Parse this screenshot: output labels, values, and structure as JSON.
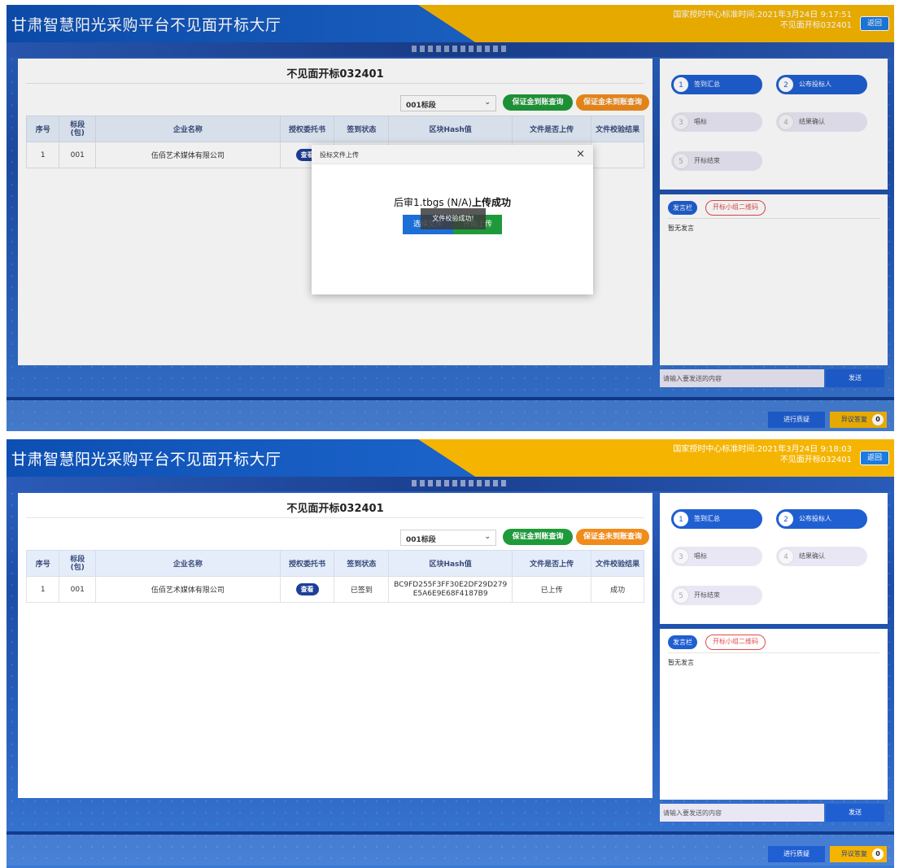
{
  "shot1": {
    "header": {
      "title": "甘肃智慧阳光采购平台不见面开标大厅",
      "time_text": "国家授时中心标准时间:2021年3月24日 9:17:51",
      "room_name": "不见面开标032401",
      "back_label": "返回"
    },
    "panel_title": "不见面开标032401",
    "segment_select": "001标段",
    "deposit_query_label": "保证金到账查询",
    "no_deposit_query_label": "保证金未到账查询",
    "table": {
      "headers": [
        "序号",
        "标段\n(包)",
        "企业名称",
        "授权委托书",
        "签到状态",
        "区块Hash值",
        "文件是否上传",
        "文件校验结果"
      ],
      "row": {
        "index": "1",
        "segment": "001",
        "company": "伍佰艺术媒体有限公司",
        "view": "查看"
      }
    },
    "modal": {
      "title": "投标文件上传",
      "close": "×",
      "message_file": "后审1.tbgs (N/A)",
      "message_status": "上传成功",
      "select_label": "选择文件",
      "upload_label": "开始上传",
      "toast": "文件校验成功!"
    },
    "steps": [
      {
        "num": "1",
        "label": "签到汇总",
        "state": "active"
      },
      {
        "num": "2",
        "label": "公布投标人",
        "state": "active"
      },
      {
        "num": "3",
        "label": "唱标",
        "state": "idle"
      },
      {
        "num": "4",
        "label": "结果确认",
        "state": "idle"
      },
      {
        "num": "5",
        "label": "开标结束",
        "state": "idle"
      }
    ],
    "chat": {
      "tab_speech": "发言栏",
      "tab_qr": "开标小组二维码",
      "empty": "暂无发言",
      "input_placeholder": "请输入要发送的内容",
      "send_label": "发送"
    },
    "footer": {
      "query_label": "进行质疑",
      "objection_label": "异议答复",
      "objection_count": "0"
    }
  },
  "shot2": {
    "header": {
      "title": "甘肃智慧阳光采购平台不见面开标大厅",
      "time_text": "国家授时中心标准时间:2021年3月24日 9:18:03",
      "room_name": "不见面开标032401",
      "back_label": "返回"
    },
    "panel_title": "不见面开标032401",
    "segment_select": "001标段",
    "deposit_query_label": "保证金到账查询",
    "no_deposit_query_label": "保证金未到账查询",
    "table": {
      "headers": [
        "序号",
        "标段\n(包)",
        "企业名称",
        "授权委托书",
        "签到状态",
        "区块Hash值",
        "文件是否上传",
        "文件校验结果"
      ],
      "row": {
        "index": "1",
        "segment": "001",
        "company": "伍佰艺术媒体有限公司",
        "view": "查看",
        "signin": "已签到",
        "hash": "BC9FD255F3FF30E2DF29D279E5A6E9E68F4187B9",
        "uploaded": "已上传",
        "verify": "成功"
      }
    },
    "steps": [
      {
        "num": "1",
        "label": "签到汇总",
        "state": "active"
      },
      {
        "num": "2",
        "label": "公布投标人",
        "state": "active"
      },
      {
        "num": "3",
        "label": "唱标",
        "state": "idle"
      },
      {
        "num": "4",
        "label": "结果确认",
        "state": "idle"
      },
      {
        "num": "5",
        "label": "开标结束",
        "state": "idle"
      }
    ],
    "chat": {
      "tab_speech": "发言栏",
      "tab_qr": "开标小组二维码",
      "empty": "暂无发言",
      "input_placeholder": "请输入要发送的内容",
      "send_label": "发送"
    },
    "footer": {
      "query_label": "进行质疑",
      "objection_label": "异议答复",
      "objection_count": "0"
    }
  },
  "colors": {
    "primary_blue": "#1f5fd1",
    "brand_yellow": "#f5b400",
    "success_green": "#1f9a3a",
    "warning_orange": "#f08c1c"
  }
}
